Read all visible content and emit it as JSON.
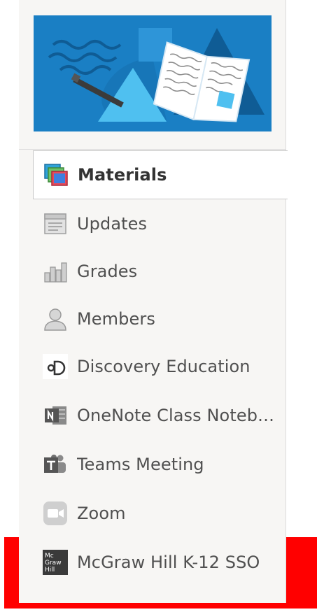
{
  "sidebar": {
    "items": [
      {
        "label": "Materials",
        "icon": "materials-icon",
        "active": true
      },
      {
        "label": "Updates",
        "icon": "updates-icon",
        "active": false
      },
      {
        "label": "Grades",
        "icon": "grades-icon",
        "active": false
      },
      {
        "label": "Members",
        "icon": "members-icon",
        "active": false
      },
      {
        "label": "Discovery Education",
        "icon": "discovery-education-icon",
        "active": false
      },
      {
        "label": "OneNote Class Notebo...",
        "icon": "onenote-icon",
        "active": false
      },
      {
        "label": "Teams Meeting",
        "icon": "teams-icon",
        "active": false
      },
      {
        "label": "Zoom",
        "icon": "zoom-icon",
        "active": false
      },
      {
        "label": "McGraw Hill K-12 SSO",
        "icon": "mcgraw-hill-icon",
        "active": false
      }
    ]
  },
  "icons": {
    "mcgraw_hill_logo_text": [
      "Mc",
      "Graw",
      "Hill"
    ]
  },
  "colors": {
    "accent": "#ff0000",
    "banner_blue": "#1a7fc4",
    "sidebar_bg": "#f7f6f4",
    "active_bg": "#ffffff",
    "text": "#505050"
  }
}
